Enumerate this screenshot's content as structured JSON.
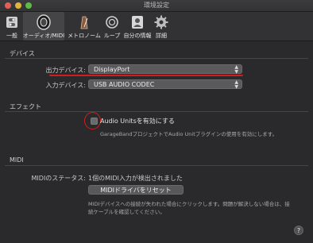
{
  "window": {
    "title": "環境設定"
  },
  "toolbar": {
    "items": [
      {
        "label": "一般",
        "icon": "toggle-switch-icon"
      },
      {
        "label": "オーディオ/MIDI",
        "icon": "speaker-icon",
        "active": true
      },
      {
        "label": "メトロノーム",
        "icon": "metronome-icon"
      },
      {
        "label": "ループ",
        "icon": "loop-icon"
      },
      {
        "label": "自分の情報",
        "icon": "person-icon"
      },
      {
        "label": "詳細",
        "icon": "gear-icon"
      }
    ]
  },
  "devices": {
    "section_title": "デバイス",
    "output_label": "出力デバイス:",
    "output_value": "DisplayPort",
    "input_label": "入力デバイス:",
    "input_value": "USB AUDIO  CODEC"
  },
  "effects": {
    "section_title": "エフェクト",
    "audio_units_label": "Audio Unitsを有効にする",
    "audio_units_checked": false,
    "description": "GarageBandプロジェクトでAudio Unitプラグインの使用を有効にします。"
  },
  "midi": {
    "section_title": "MIDI",
    "status_label": "MIDIのステータス:",
    "status_value": "1個のMIDI入力が検出されました",
    "reset_button": "MIDIドライバをリセット",
    "description_line1": "MIDIデバイスへの接続が失われた場合にクリックします。問題が解決しない場合は、接",
    "description_line2": "続ケーブルを確認してください。"
  },
  "help_button": "?",
  "colors": {
    "annotation_red": "#d21d1d",
    "window_bg": "#2a2a2c"
  }
}
